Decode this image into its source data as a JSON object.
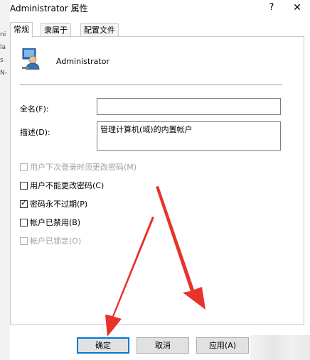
{
  "background": {
    "fragments": [
      "ni",
      "la",
      "s",
      "N-"
    ]
  },
  "dialog": {
    "title": "Administrator 属性",
    "help": "?",
    "close": "✕"
  },
  "tabs": [
    {
      "label": "常规",
      "active": true
    },
    {
      "label": "隶属于",
      "active": false
    },
    {
      "label": "配置文件",
      "active": false
    }
  ],
  "general": {
    "user_name": "Administrator",
    "full_name_label": "全名(F):",
    "full_name_value": "",
    "description_label": "描述(D):",
    "description_value": "管理计算机(域)的内置帐户",
    "checkboxes": [
      {
        "label": "用户下次登录时须更改密码(M)",
        "checked": false,
        "enabled": false
      },
      {
        "label": "用户不能更改密码(C)",
        "checked": false,
        "enabled": true
      },
      {
        "label": "密码永不过期(P)",
        "checked": true,
        "enabled": true
      },
      {
        "label": "帐户已禁用(B)",
        "checked": false,
        "enabled": true
      },
      {
        "label": "帐户已锁定(O)",
        "checked": false,
        "enabled": false
      }
    ]
  },
  "buttons": {
    "ok": "确定",
    "cancel": "取消",
    "apply": "应用(A)"
  },
  "colors": {
    "annotation_arrow": "#e8322a",
    "focus_border": "#0078d7"
  }
}
